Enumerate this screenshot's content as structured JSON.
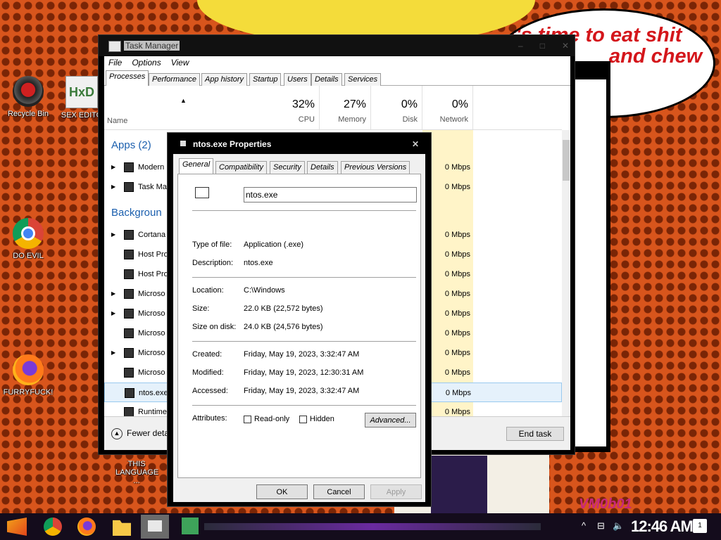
{
  "wallpaper": {
    "speech": [
      "it's time to eat shit",
      "and chew",
      "d",
      "lew"
    ],
    "watermark": "VM0b01"
  },
  "desktop_icons": [
    {
      "label": "Recycle Bin",
      "icon": "recycle-bin-icon"
    },
    {
      "label": "SEX EDITO",
      "icon": "hex-editor-icon"
    },
    {
      "label": "DO EVIL",
      "icon": "chrome-icon"
    },
    {
      "label": "FURRYFUCK!",
      "icon": "firefox-icon"
    },
    {
      "label": "THIS LANGUAGE ...",
      "icon": "document-icon"
    }
  ],
  "task_manager": {
    "title": "Task Manager",
    "window_controls": [
      "–",
      "□",
      "✕"
    ],
    "menu": [
      "File",
      "Options",
      "View"
    ],
    "tabs": [
      "Processes",
      "Performance",
      "App history",
      "Startup",
      "Users",
      "Details",
      "Services"
    ],
    "active_tab": "Processes",
    "columns": {
      "name": "Name",
      "cpu": {
        "pct": "32%",
        "label": "CPU"
      },
      "memory": {
        "pct": "27%",
        "label": "Memory"
      },
      "disk": {
        "pct": "0%",
        "label": "Disk"
      },
      "network": {
        "pct": "0%",
        "label": "Network"
      }
    },
    "groups": {
      "apps": "Apps (2)",
      "background": "Backgroun"
    },
    "rows": [
      {
        "name": "Modern",
        "network": "0 Mbps"
      },
      {
        "name": "Task Ma",
        "network": "0 Mbps"
      },
      {
        "name": "Cortana",
        "network": "0 Mbps"
      },
      {
        "name": "Host Pro",
        "network": "0 Mbps"
      },
      {
        "name": "Host Pro",
        "network": "0 Mbps"
      },
      {
        "name": "Microso",
        "network": "0 Mbps"
      },
      {
        "name": "Microso",
        "network": "0 Mbps"
      },
      {
        "name": "Microso",
        "network": "0 Mbps"
      },
      {
        "name": "Microso",
        "network": "0 Mbps"
      },
      {
        "name": "Microso",
        "network": "0 Mbps"
      },
      {
        "name": "ntos.exe",
        "network": "0 Mbps"
      },
      {
        "name": "Runtime",
        "network": "0 Mbps"
      }
    ],
    "fewer_details": "Fewer deta",
    "end_task": "End task"
  },
  "properties": {
    "title": "ntos.exe Properties",
    "close": "✕",
    "tabs": [
      "General",
      "Compatibility",
      "Security",
      "Details",
      "Previous Versions"
    ],
    "active_tab": "General",
    "filename": "ntos.exe",
    "type_label": "Type of file:",
    "type_value": "Application (.exe)",
    "desc_label": "Description:",
    "desc_value": "ntos.exe",
    "location_label": "Location:",
    "location_value": "C:\\Windows",
    "size_label": "Size:",
    "size_value": "22.0 KB (22,572 bytes)",
    "sizeondisk_label": "Size on disk:",
    "sizeondisk_value": "24.0 KB (24,576 bytes)",
    "created_label": "Created:",
    "created_value": "Friday, May 19, 2023, 3:32:47 AM",
    "modified_label": "Modified:",
    "modified_value": "Friday, May 19, 2023, 12:30:31 AM",
    "accessed_label": "Accessed:",
    "accessed_value": "Friday, May 19, 2023, 3:32:47 AM",
    "attributes_label": "Attributes:",
    "readonly": "Read-only",
    "hidden": "Hidden",
    "advanced": "Advanced...",
    "ok": "OK",
    "cancel": "Cancel",
    "apply": "Apply"
  },
  "taskbar": {
    "clock": "12:46 AM",
    "notifications": "1",
    "tray": [
      "^",
      "⊟",
      "🔈"
    ]
  }
}
